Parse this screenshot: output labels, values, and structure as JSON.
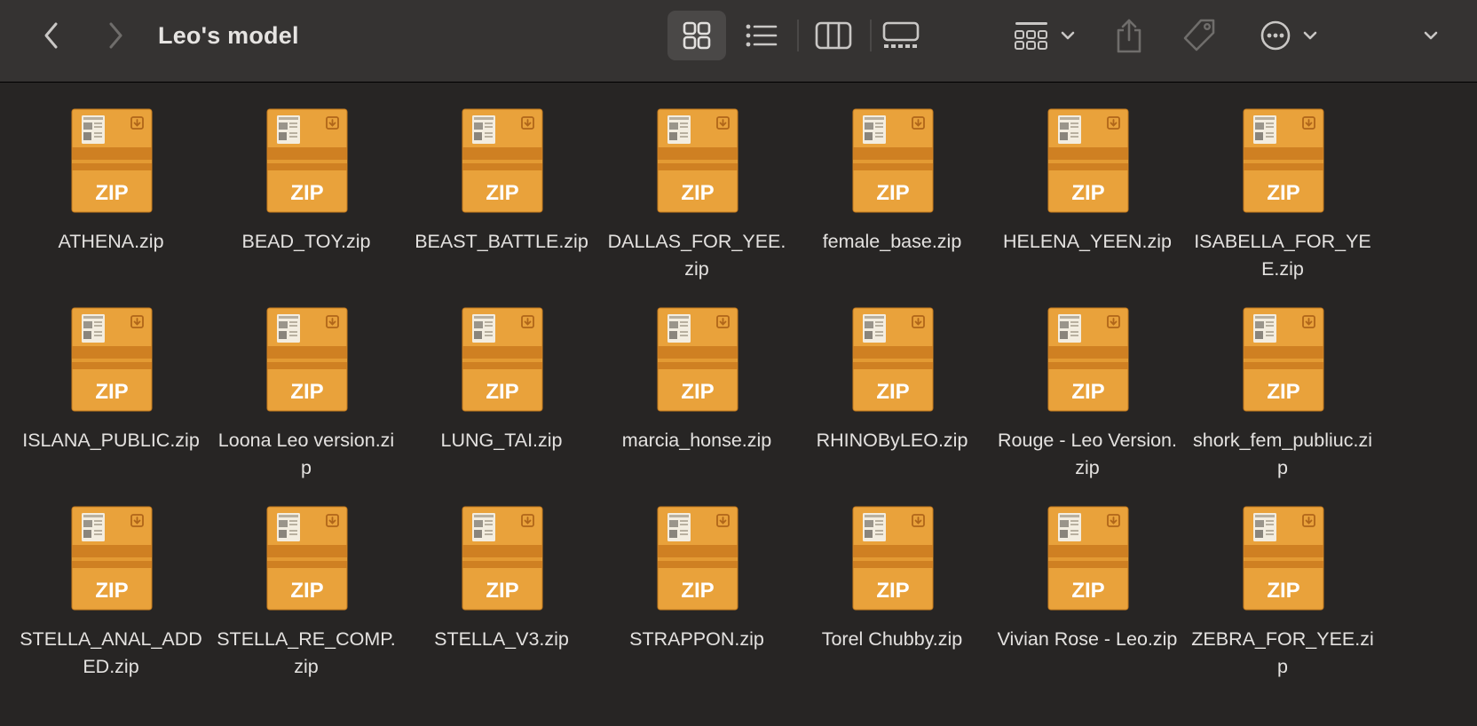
{
  "window": {
    "title": "Leo's model"
  },
  "toolbar": {
    "back_icon": "chevron-left-icon",
    "forward_icon": "chevron-right-icon",
    "view_icons": [
      "icon-view-icon",
      "list-view-icon",
      "column-view-icon",
      "gallery-view-icon"
    ],
    "group_icon": "group-grid-icon",
    "share_icon": "share-icon",
    "tag_icon": "tag-icon",
    "more_icon": "ellipsis-circle-icon",
    "expand_icon": "chevron-down-icon"
  },
  "colors": {
    "toolbar_bg": "#353332",
    "window_bg": "#272524",
    "zip_main": "#e9a23b",
    "zip_band": "#cf8022",
    "zip_text": "#ffffff"
  },
  "zip_label": "ZIP",
  "files": [
    {
      "name": "ATHENA.zip"
    },
    {
      "name": "BEAD_TOY.zip"
    },
    {
      "name": "BEAST_BATTLE.zip"
    },
    {
      "name": "DALLAS_FOR_YEE.zip"
    },
    {
      "name": "female_base.zip"
    },
    {
      "name": "HELENA_YEEN.zip"
    },
    {
      "name": "ISABELLA_FOR_YEE.zip"
    },
    {
      "name": "ISLANA_PUBLIC.zip"
    },
    {
      "name": "Loona Leo version.zip"
    },
    {
      "name": "LUNG_TAI.zip"
    },
    {
      "name": "marcia_honse.zip"
    },
    {
      "name": "RHINOByLEO.zip"
    },
    {
      "name": "Rouge - Leo Version.zip"
    },
    {
      "name": "shork_fem_publiuc.zip"
    },
    {
      "name": "STELLA_ANAL_ADDED.zip"
    },
    {
      "name": "STELLA_RE_COMP.zip"
    },
    {
      "name": "STELLA_V3.zip"
    },
    {
      "name": "STRAPPON.zip"
    },
    {
      "name": "Torel Chubby.zip"
    },
    {
      "name": "Vivian Rose - Leo.zip"
    },
    {
      "name": "ZEBRA_FOR_YEE.zip"
    }
  ]
}
